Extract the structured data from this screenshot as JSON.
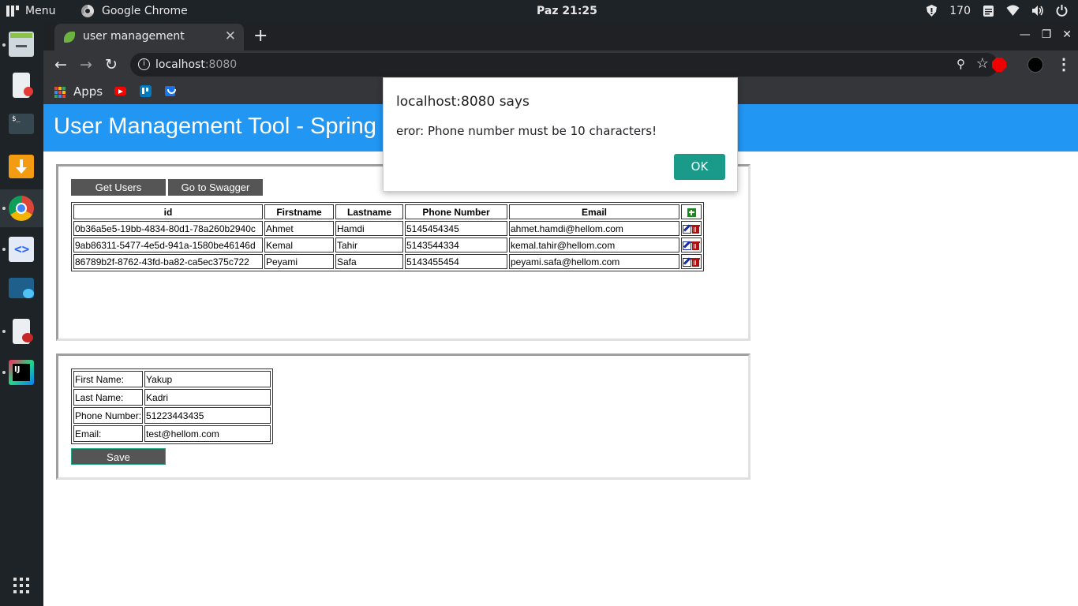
{
  "system_bar": {
    "menu_label": "Menu",
    "active_app": "Google Chrome",
    "clock": "Paz 21:25",
    "tray_count": "170"
  },
  "browser": {
    "tab_title": "user management",
    "url_host": "localhost",
    "url_port": ":8080",
    "bookmarks": {
      "apps_label": "Apps"
    }
  },
  "page": {
    "header_title": "User Management Tool - Spring Boot",
    "buttons": {
      "get_users": "Get Users",
      "go_to_swagger": "Go to Swagger",
      "save": "Save"
    },
    "table": {
      "headers": [
        "id",
        "Firstname",
        "Lastname",
        "Phone Number",
        "Email"
      ],
      "rows": [
        {
          "id": "0b36a5e5-19bb-4834-80d1-78a260b2940c",
          "firstname": "Ahmet",
          "lastname": "Hamdi",
          "phone": "5145454345",
          "email": "ahmet.hamdi@hellom.com"
        },
        {
          "id": "9ab86311-5477-4e5d-941a-1580be46146d",
          "firstname": "Kemal",
          "lastname": "Tahir",
          "phone": "5143544334",
          "email": "kemal.tahir@hellom.com"
        },
        {
          "id": "86789b2f-8762-43fd-ba82-ca5ec375c722",
          "firstname": "Peyami",
          "lastname": "Safa",
          "phone": "5143455454",
          "email": "peyami.safa@hellom.com"
        }
      ]
    },
    "form": {
      "first_name_label": "First Name:",
      "first_name_value": "Yakup",
      "last_name_label": "Last Name:",
      "last_name_value": "Kadri",
      "phone_label": "Phone Number:",
      "phone_value": "51223443435",
      "email_label": "Email:",
      "email_value": "test@hellom.com"
    }
  },
  "dialog": {
    "title": "localhost:8080 says",
    "message": "eror: Phone number must be 10 characters!",
    "ok_label": "OK"
  },
  "colors": {
    "header_bg": "#2196f3",
    "button_bg": "#555555",
    "dialog_ok": "#1a9b8a",
    "add_icon": "#1b8a1b",
    "edit_icon": "#1a2aa8",
    "delete_icon": "#b01010"
  }
}
